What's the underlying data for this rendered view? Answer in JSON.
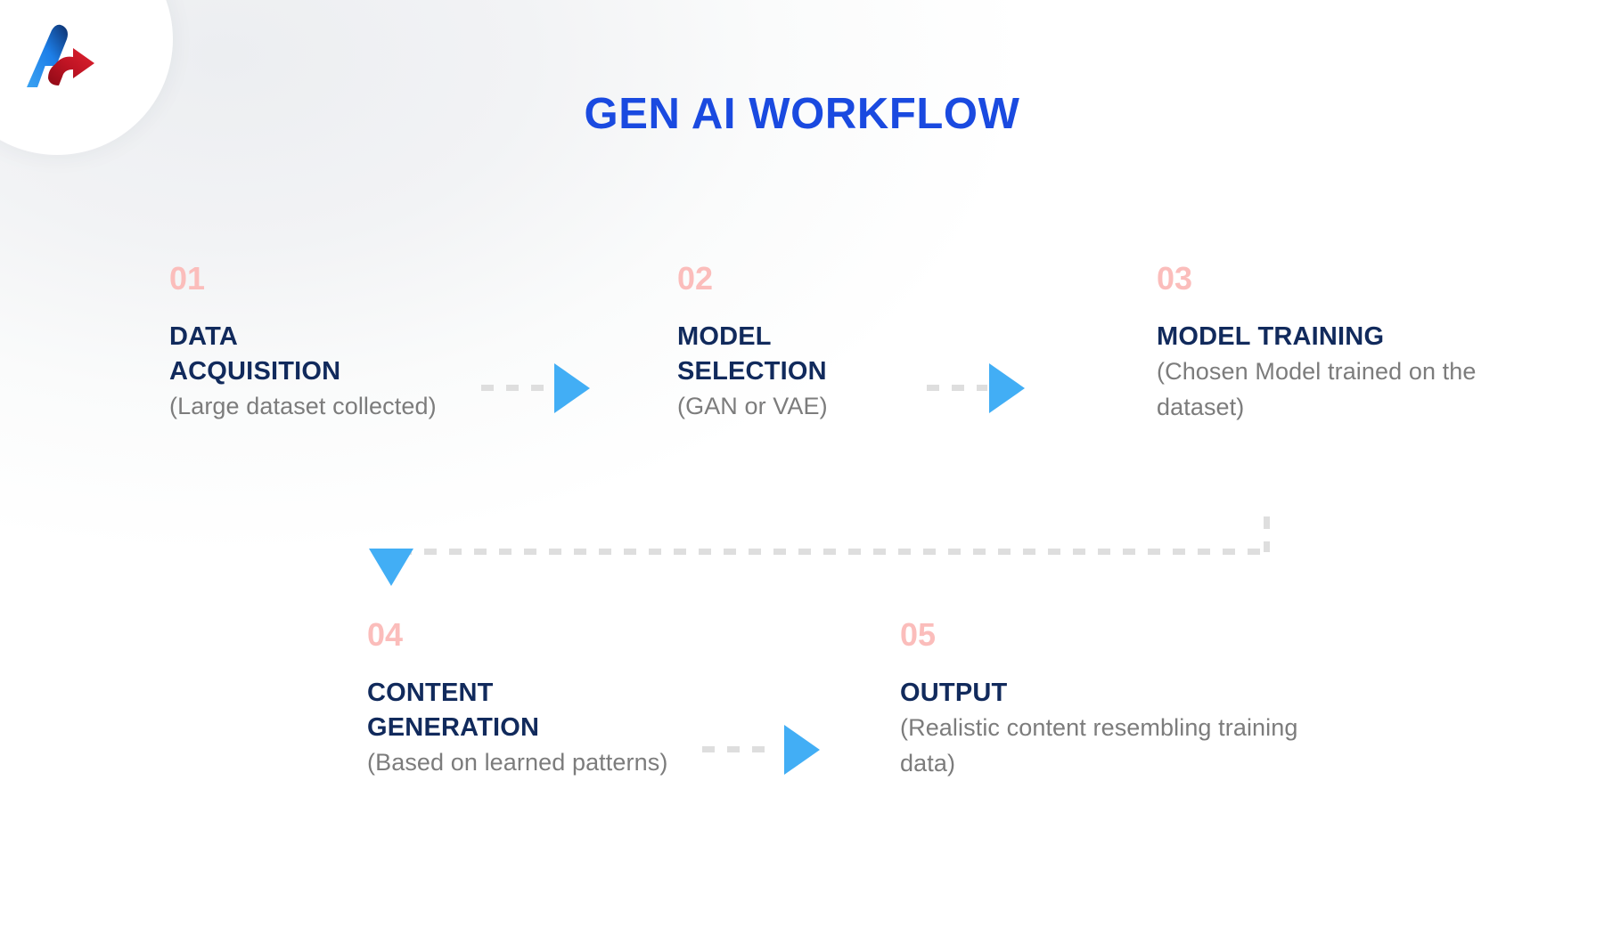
{
  "header": {
    "title": "GEN AI WORKFLOW",
    "title_color": "#1a4ae0"
  },
  "logo": {
    "name": "brand-logo",
    "blue_color": "#1d7fe8",
    "dark_blue_color": "#0d2f6b",
    "red_color": "#b4121f"
  },
  "palette": {
    "step_number": "#fbbdbb",
    "step_title": "#112a5c",
    "step_desc": "#7c7c7c",
    "arrow": "#42aef5",
    "dash": "#dedede",
    "background": "#ffffff"
  },
  "chart_data": {
    "type": "diagram",
    "title": "GEN AI WORKFLOW",
    "layout": "snake-flow, 3 steps top row left-to-right, 2 steps bottom row left-to-right",
    "nodes": [
      {
        "number": "01",
        "title": "DATA ACQUISITION",
        "desc": "(Large dataset collected)"
      },
      {
        "number": "02",
        "title": "MODEL SELECTION",
        "desc": "(GAN or VAE)"
      },
      {
        "number": "03",
        "title": "MODEL TRAINING",
        "desc": "(Chosen Model trained on the dataset)"
      },
      {
        "number": "04",
        "title": "CONTENT GENERATION",
        "desc": "(Based on learned patterns)"
      },
      {
        "number": "05",
        "title": "OUTPUT",
        "desc": "(Realistic content resembling training data)"
      }
    ],
    "edges": [
      {
        "from": "01",
        "to": "02",
        "style": "dashed",
        "direction": "right"
      },
      {
        "from": "02",
        "to": "03",
        "style": "dashed",
        "direction": "right"
      },
      {
        "from": "03",
        "to": "04",
        "style": "dashed",
        "direction": "down-then-left-then-down"
      },
      {
        "from": "04",
        "to": "05",
        "style": "dashed",
        "direction": "right"
      }
    ]
  },
  "steps": [
    {
      "number": "01",
      "title_line1": "DATA",
      "title_line2": "ACQUISITION",
      "desc": "(Large dataset collected)"
    },
    {
      "number": "02",
      "title_line1": "MODEL",
      "title_line2": "SELECTION",
      "desc": "(GAN or VAE)"
    },
    {
      "number": "03",
      "title_line1": "MODEL TRAINING",
      "title_line2": "",
      "desc": "(Chosen Model trained on the dataset)"
    },
    {
      "number": "04",
      "title_line1": "CONTENT",
      "title_line2": "GENERATION",
      "desc": "(Based on learned patterns)"
    },
    {
      "number": "05",
      "title_line1": "OUTPUT",
      "title_line2": "",
      "desc": "(Realistic content resembling training data)"
    }
  ]
}
